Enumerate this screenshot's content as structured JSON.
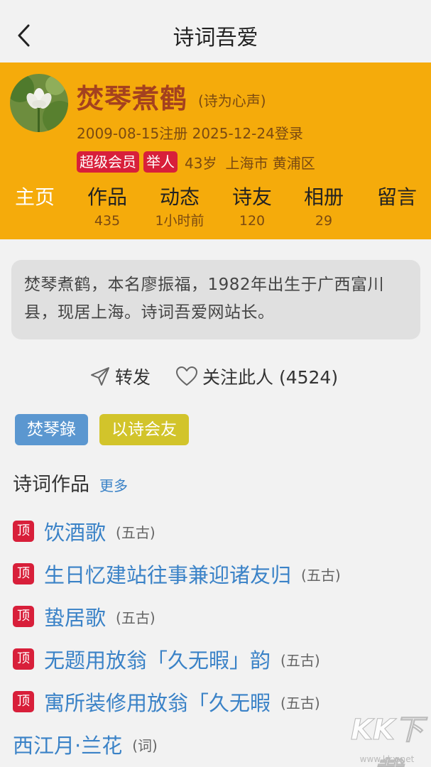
{
  "header": {
    "title": "诗词吾爱"
  },
  "profile": {
    "name": "焚琴煮鹤",
    "motto": "(诗为心声)",
    "register_date": "2009-08-15注册",
    "login_date": "2025-12-24登录",
    "badges": [
      "超级会员",
      "举人"
    ],
    "age": "43岁",
    "location": "上海市 黄浦区",
    "colors": {
      "background": "#f5ab0b",
      "name": "#a4411f",
      "badge": "#d81f3a"
    }
  },
  "tabs": [
    {
      "label": "主页",
      "count": ""
    },
    {
      "label": "作品",
      "count": "435"
    },
    {
      "label": "动态",
      "count": "1小时前"
    },
    {
      "label": "诗友",
      "count": "120"
    },
    {
      "label": "相册",
      "count": "29"
    },
    {
      "label": "留言",
      "count": ""
    }
  ],
  "intro": "焚琴煮鹤，本名廖振福，1982年出生于广西富川县，现居上海。诗词吾爱网站长。",
  "actions": {
    "share_label": "转发",
    "share_icon": "paper-plane-icon",
    "follow_label": "关注此人 (4524)",
    "follow_icon": "heart-icon"
  },
  "chips": [
    "焚琴錄",
    "以诗会友"
  ],
  "works_section": {
    "title": "诗词作品",
    "more_label": "更多",
    "top_badge": "顶",
    "items": [
      {
        "title": "饮酒歌",
        "genre": "(五古)",
        "pinned": true
      },
      {
        "title": "生日忆建站往事兼迎诸友归",
        "genre": "(五古)",
        "pinned": true
      },
      {
        "title": "蛰居歌",
        "genre": "(五古)",
        "pinned": true
      },
      {
        "title": "无题用放翁「久无暇」韵",
        "genre": "(五古)",
        "pinned": true
      },
      {
        "title": "寓所装修用放翁「久无暇",
        "genre": "(五古)",
        "pinned": true
      },
      {
        "title": "西江月·兰花",
        "genre": "(词)",
        "pinned": false
      }
    ]
  },
  "watermark": {
    "logo": "KK下载",
    "url": "www.kkx.net"
  }
}
